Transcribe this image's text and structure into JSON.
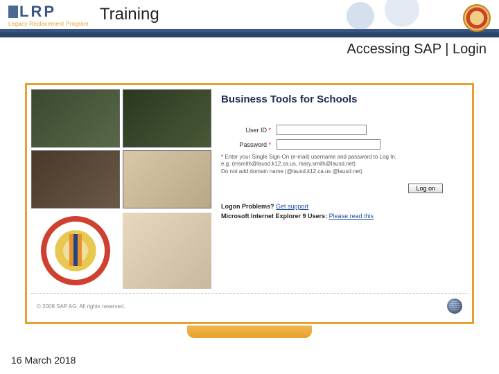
{
  "header": {
    "logo_text": "LRP",
    "logo_sub": "Legacy Replacement Program",
    "title": "Training"
  },
  "subheader": {
    "text": "Accessing SAP | Login"
  },
  "panel": {
    "title": "Business Tools for Schools",
    "user_label": "User ID",
    "user_value": "",
    "password_label": "Password",
    "password_value": "",
    "hint_line1": "* Enter your Single Sign-On (e-mail) username and password to Log In.",
    "hint_line2": "e.g. (msmith@lausd.k12.ca.us, mary.smith@lausd.net)",
    "hint_line3": "Do not add domain name (@lausd.k12.ca.us @lausd.net)",
    "logon_label": "Log on",
    "help": {
      "label": "Logon Problems?",
      "link": "Get support"
    },
    "ie9": {
      "label": "Microsoft Internet Explorer 9 Users:",
      "link": "Please read this"
    },
    "copyright": "© 2008 SAP AG. All rights reserved."
  },
  "footer": {
    "date": "16 March 2018"
  }
}
